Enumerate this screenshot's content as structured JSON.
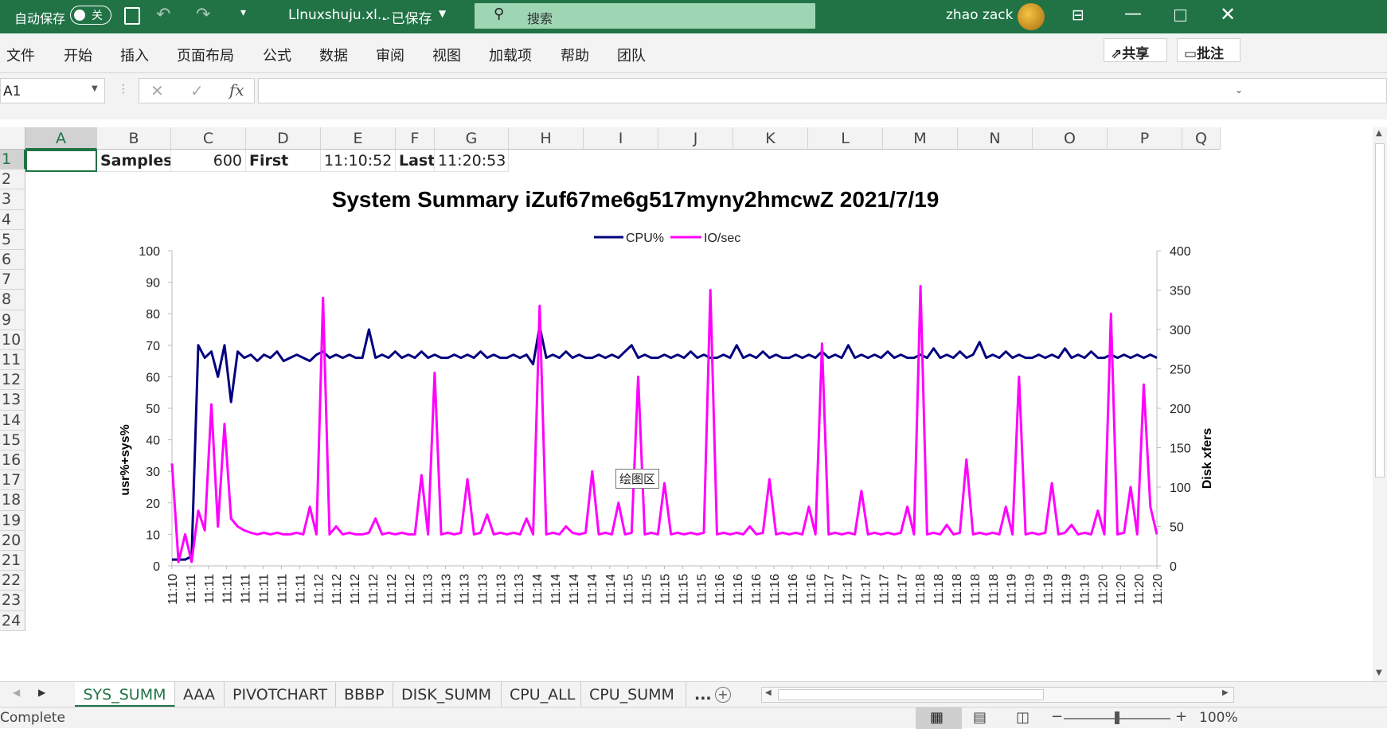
{
  "titlebar": {
    "autosave_label": "自动保存",
    "autosave_state": "关",
    "filename": "Llnuxshuju.xl...",
    "saved_status": "- 已保存",
    "search_placeholder": "搜索",
    "user": "zhao zack"
  },
  "menu": [
    "文件",
    "开始",
    "插入",
    "页面布局",
    "公式",
    "数据",
    "审阅",
    "视图",
    "加载项",
    "帮助",
    "团队"
  ],
  "share_label": "共享",
  "comment_label": "批注",
  "formula": {
    "namebox": "A1",
    "content": ""
  },
  "columns": [
    "A",
    "B",
    "C",
    "D",
    "E",
    "F",
    "G",
    "H",
    "I",
    "J",
    "K",
    "L",
    "M",
    "N",
    "O",
    "P",
    "Q"
  ],
  "rows": [
    "1",
    "2",
    "3",
    "4",
    "5",
    "6",
    "7",
    "8",
    "9",
    "10",
    "11",
    "12",
    "13",
    "14",
    "15",
    "16",
    "17",
    "18",
    "19",
    "20",
    "21",
    "22",
    "23",
    "24"
  ],
  "row1": {
    "B": "Samples",
    "C": "600",
    "D": "First",
    "E": "11:10:52",
    "F": "Last",
    "G": "11:20:53"
  },
  "tooltip": "绘图区",
  "chart_data": {
    "type": "line",
    "title": "System Summary iZuf67me6g517myny2hmcwZ  2021/7/19",
    "xlabel": "",
    "ylabel": "usr%+sys%",
    "y2label": "Disk xfers",
    "ylim": [
      0,
      100
    ],
    "y2lim": [
      0,
      400
    ],
    "yticks": [
      "0",
      "10",
      "20",
      "30",
      "40",
      "50",
      "60",
      "70",
      "80",
      "90",
      "100"
    ],
    "y2ticks": [
      "0",
      "50",
      "100",
      "150",
      "200",
      "250",
      "300",
      "350",
      "400"
    ],
    "xtick_labels": [
      "11:10",
      "11:11",
      "11:11",
      "11:11",
      "11:11",
      "11:11",
      "11:11",
      "11:11",
      "11:12",
      "11:12",
      "11:12",
      "11:12",
      "11:12",
      "11:12",
      "11:13",
      "11:13",
      "11:13",
      "11:13",
      "11:13",
      "11:13",
      "11:14",
      "11:14",
      "11:14",
      "11:14",
      "11:14",
      "11:15",
      "11:15",
      "11:15",
      "11:15",
      "11:15",
      "11:16",
      "11:16",
      "11:16",
      "11:16",
      "11:16",
      "11:16",
      "11:17",
      "11:17",
      "11:17",
      "11:17",
      "11:17",
      "11:18",
      "11:18",
      "11:18",
      "11:18",
      "11:18",
      "11:19",
      "11:19",
      "11:19",
      "11:19",
      "11:19",
      "11:20",
      "11:20",
      "11:20",
      "11:20"
    ],
    "legend": "top",
    "series": [
      {
        "name": "CPU%",
        "axis": "left",
        "color": "#00007f",
        "values": [
          2,
          2,
          2,
          3,
          70,
          66,
          68,
          60,
          70,
          52,
          68,
          66,
          67,
          65,
          67,
          66,
          68,
          65,
          66,
          67,
          66,
          65,
          67,
          68,
          66,
          67,
          66,
          67,
          66,
          66,
          75,
          66,
          67,
          66,
          68,
          66,
          67,
          66,
          68,
          66,
          67,
          66,
          66,
          67,
          66,
          67,
          66,
          68,
          66,
          67,
          66,
          66,
          67,
          66,
          67,
          64,
          76,
          66,
          67,
          66,
          68,
          66,
          67,
          66,
          66,
          67,
          66,
          67,
          66,
          68,
          70,
          66,
          67,
          66,
          66,
          67,
          66,
          67,
          66,
          68,
          66,
          67,
          66,
          66,
          67,
          66,
          70,
          66,
          67,
          66,
          68,
          66,
          67,
          66,
          66,
          67,
          66,
          67,
          66,
          68,
          66,
          67,
          66,
          70,
          66,
          67,
          66,
          67,
          66,
          68,
          66,
          67,
          66,
          66,
          67,
          66,
          69,
          66,
          67,
          66,
          68,
          66,
          67,
          71,
          66,
          67,
          66,
          68,
          66,
          67,
          66,
          66,
          67,
          66,
          67,
          66,
          69,
          66,
          67,
          66,
          68,
          66,
          66,
          67,
          66,
          67,
          66,
          67,
          66,
          67,
          66
        ]
      },
      {
        "name": "IO/sec",
        "axis": "right",
        "color": "#ff00ff",
        "values": [
          130,
          5,
          40,
          5,
          70,
          45,
          205,
          50,
          180,
          60,
          50,
          45,
          42,
          40,
          42,
          40,
          42,
          40,
          40,
          42,
          40,
          75,
          40,
          340,
          40,
          50,
          40,
          42,
          40,
          40,
          42,
          60,
          40,
          42,
          40,
          42,
          40,
          40,
          115,
          40,
          245,
          40,
          42,
          40,
          42,
          110,
          40,
          42,
          65,
          40,
          42,
          40,
          42,
          40,
          60,
          40,
          330,
          40,
          42,
          40,
          50,
          42,
          40,
          42,
          120,
          40,
          42,
          40,
          80,
          40,
          42,
          240,
          40,
          42,
          40,
          105,
          40,
          42,
          40,
          42,
          40,
          42,
          350,
          40,
          42,
          40,
          42,
          40,
          50,
          40,
          42,
          110,
          40,
          42,
          40,
          42,
          40,
          75,
          40,
          282,
          40,
          42,
          40,
          42,
          40,
          95,
          40,
          42,
          40,
          42,
          40,
          42,
          75,
          40,
          355,
          40,
          42,
          40,
          52,
          40,
          42,
          135,
          40,
          42,
          40,
          42,
          40,
          75,
          40,
          240,
          40,
          42,
          40,
          42,
          105,
          40,
          42,
          52,
          40,
          42,
          40,
          70,
          40,
          320,
          40,
          42,
          100,
          40,
          230,
          75,
          40
        ]
      }
    ]
  },
  "sheets": [
    "SYS_SUMM",
    "AAA",
    "PIVOTCHART",
    "BBBP",
    "DISK_SUMM",
    "CPU_ALL",
    "CPU_SUMM",
    "..."
  ],
  "status": {
    "text": "Complete",
    "zoom": "100%"
  }
}
